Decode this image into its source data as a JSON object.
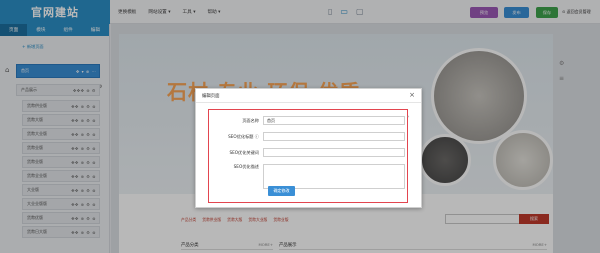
{
  "app": {
    "logo": "官网建站"
  },
  "menu": [
    "更换模板",
    "网站设置 ▾",
    "工具 ▾",
    "帮助 ▾"
  ],
  "toolbar": {
    "preview": "预览",
    "publish": "发布",
    "save": "保存",
    "back": "⊙ 返回会员管理"
  },
  "sidebar": {
    "tabs": [
      "页面",
      "模块",
      "组件",
      "编辑"
    ],
    "new_page": "+ 新增页面",
    "pages": [
      {
        "label": "首页",
        "selected": true
      },
      {
        "label": "产品展示",
        "selected": false
      },
      {
        "label": "货幣供业版",
        "selected": false
      },
      {
        "label": "货幣大版",
        "selected": false
      },
      {
        "label": "货幣大业版",
        "selected": false
      },
      {
        "label": "货幣业版",
        "selected": false
      },
      {
        "label": "货幣业版",
        "selected": false
      },
      {
        "label": "货幣全业版",
        "selected": false
      },
      {
        "label": "大业版",
        "selected": false
      },
      {
        "label": "大业业版版",
        "selected": false
      },
      {
        "label": "货幣优版",
        "selected": false
      },
      {
        "label": "货幣日大版",
        "selected": false
      }
    ]
  },
  "site": {
    "banner_text": "石材 专业·环保·优质",
    "nav_links": [
      "产品分类",
      "货幣供业版",
      "货幣大版",
      "货幣大业版",
      "货幣业版"
    ],
    "search_button": "搜索",
    "section_left": "产品分类",
    "section_right": "产品展示",
    "more": "MORE+"
  },
  "modal": {
    "title": "编辑页面",
    "close": "×",
    "fields": [
      {
        "label": "页面名称",
        "value": "首页",
        "type": "input"
      },
      {
        "label": "SEO优化标题 ⓘ",
        "value": "",
        "type": "input"
      },
      {
        "label": "SEO优化关键词",
        "value": "",
        "type": "input"
      },
      {
        "label": "SEO优化描述",
        "value": "",
        "type": "textarea"
      }
    ],
    "required_mark": "*",
    "confirm": "确定修改"
  },
  "colors": {
    "brand": "#2c8fc6",
    "highlight": "#e3454f",
    "accent_red": "#c0392b"
  }
}
